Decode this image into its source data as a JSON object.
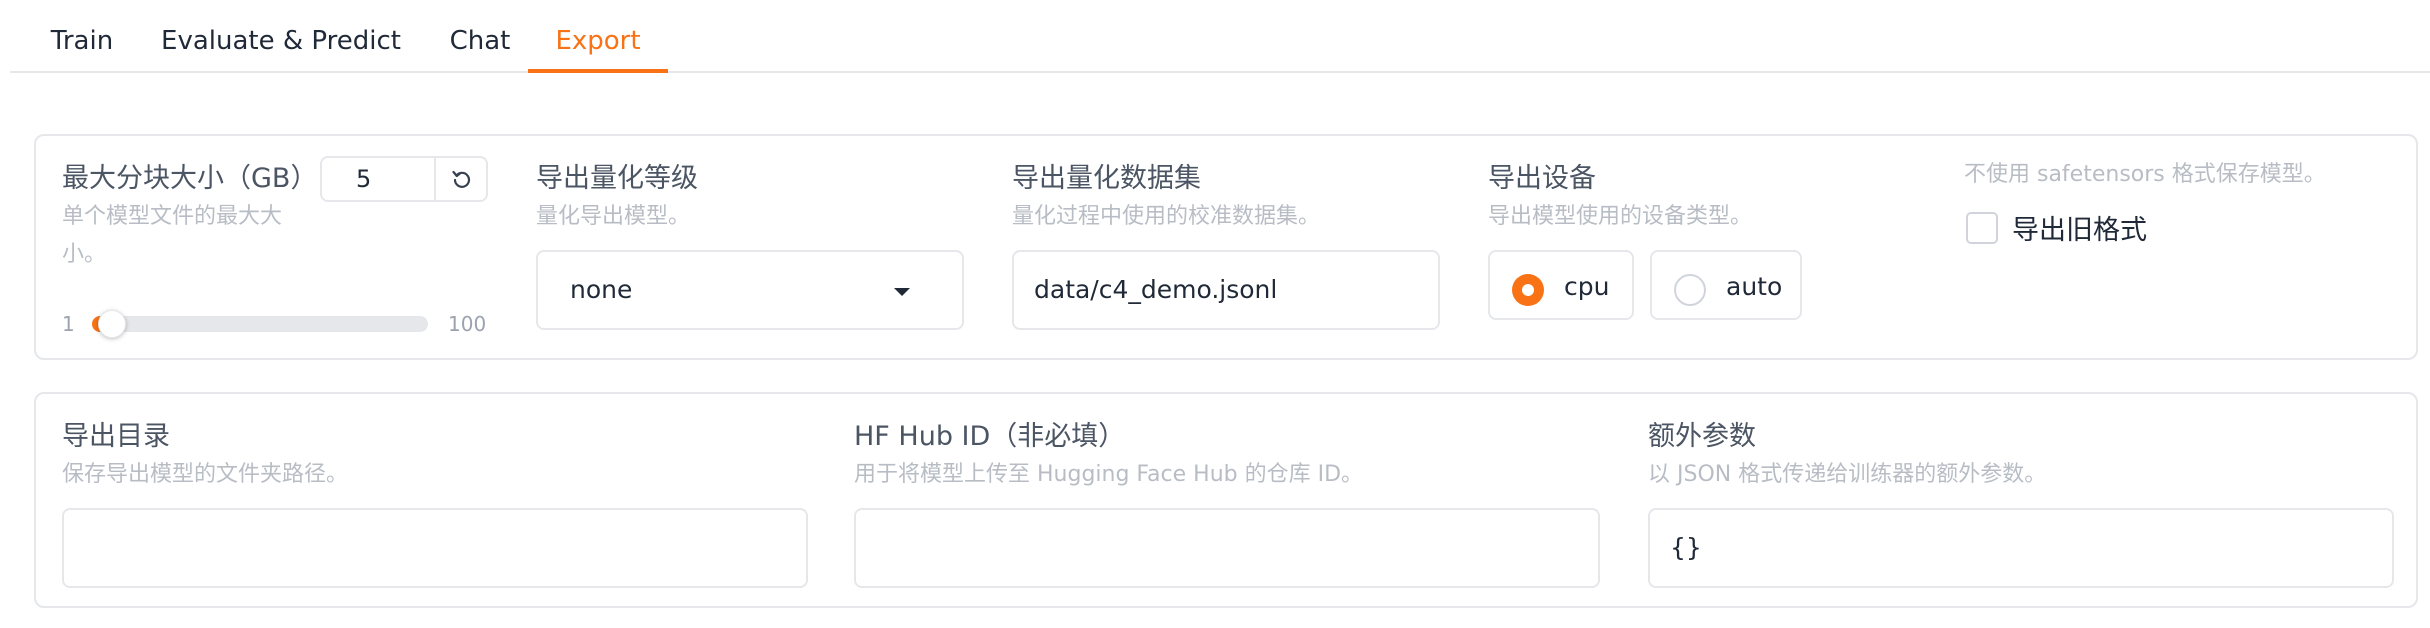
{
  "tabs": [
    "Train",
    "Evaluate & Predict",
    "Chat",
    "Export"
  ],
  "row1": {
    "max_shard": {
      "label": "最大分块大小（GB）",
      "info_line1": "单个模型文件的最大大",
      "info_line2": "小。",
      "value": "5",
      "min": "1",
      "max": "100",
      "reset_icon": "reset-icon"
    },
    "quant_bit": {
      "label": "导出量化等级",
      "info": "量化导出模型。",
      "value": "none"
    },
    "quant_dataset": {
      "label": "导出量化数据集",
      "info": "量化过程中使用的校准数据集。",
      "value": "data/c4_demo.jsonl"
    },
    "device": {
      "label": "导出设备",
      "info": "导出模型使用的设备类型。",
      "options": [
        "cpu",
        "auto"
      ],
      "selected": "cpu"
    },
    "legacy": {
      "info": "不使用 safetensors 格式保存模型。",
      "label": "导出旧格式",
      "checked": false
    }
  },
  "row2": {
    "export_dir": {
      "label": "导出目录",
      "info": "保存导出模型的文件夹路径。",
      "value": ""
    },
    "hub_id": {
      "label": "HF Hub ID（非必填）",
      "info": "用于将模型上传至 Hugging Face Hub 的仓库 ID。",
      "value": ""
    },
    "extra_args": {
      "label": "额外参数",
      "info": "以 JSON 格式传递给训练器的额外参数。",
      "value": "{}"
    }
  },
  "accent_color": "#f97316"
}
